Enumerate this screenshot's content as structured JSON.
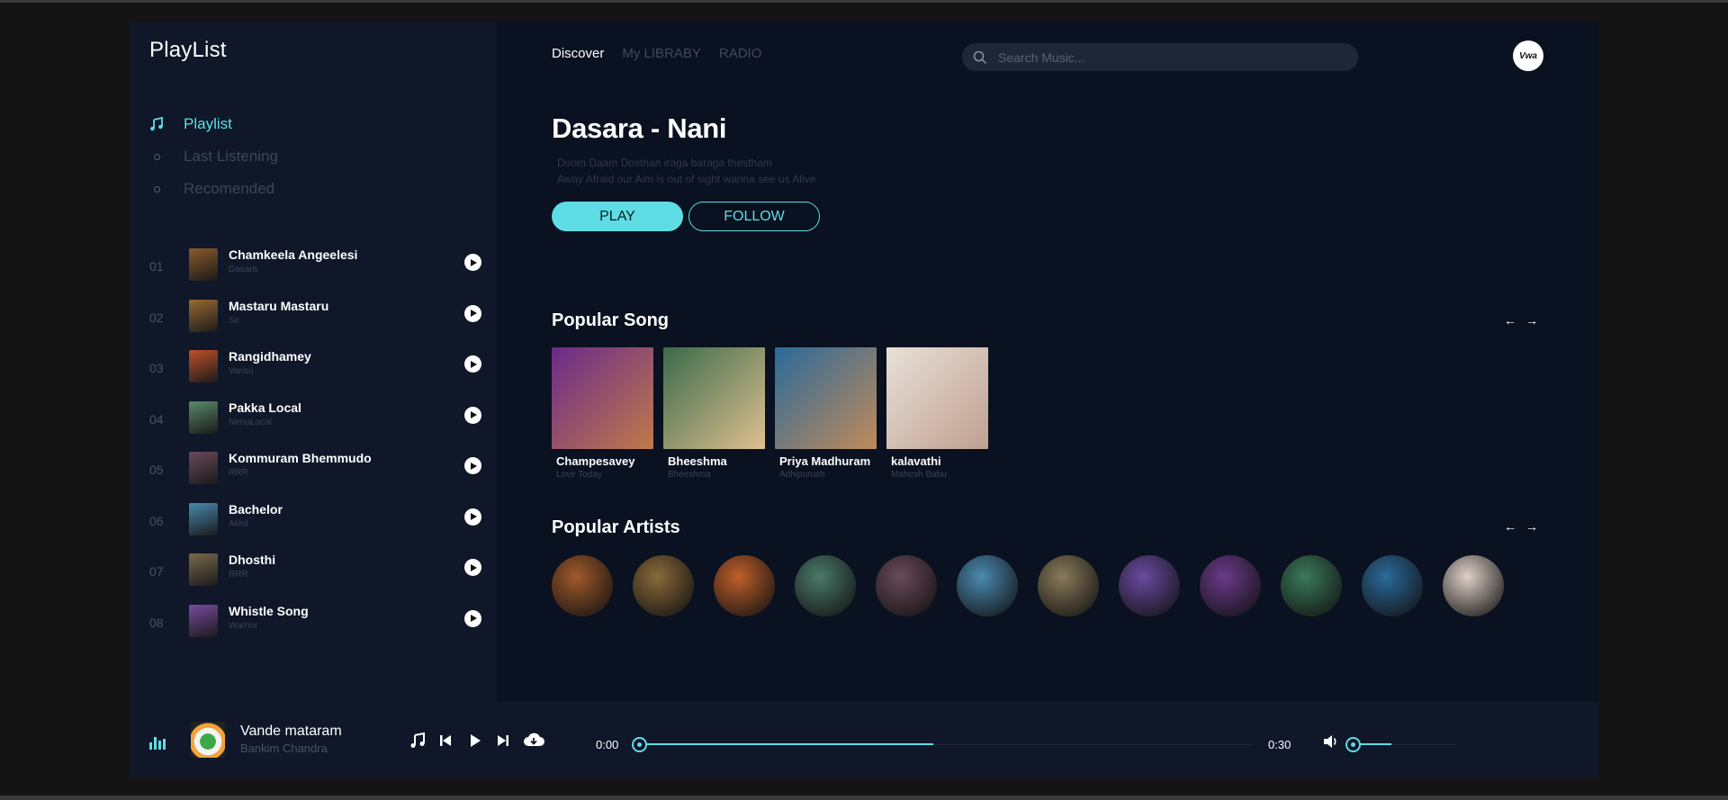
{
  "sidebar": {
    "brand": "PlayList",
    "nav": [
      {
        "label": "Playlist",
        "active": true,
        "icon": "music-note-icon"
      },
      {
        "label": "Last Listening",
        "active": false,
        "icon": "circle-icon"
      },
      {
        "label": "Recomended",
        "active": false,
        "icon": "circle-icon"
      }
    ],
    "tracks": [
      {
        "num": "01",
        "title": "Chamkeela Angeelesi",
        "artist": "Dasara",
        "color": "#8a5a2a"
      },
      {
        "num": "02",
        "title": "Mastaru Mastaru",
        "artist": "Sir",
        "color": "#9a6a30"
      },
      {
        "num": "03",
        "title": "Rangidhamey",
        "artist": "Varisu",
        "color": "#c0502a"
      },
      {
        "num": "04",
        "title": "Pakka Local",
        "artist": "NenuLocal",
        "color": "#5a8a6a"
      },
      {
        "num": "05",
        "title": "Kommuram Bhemmudo",
        "artist": "RRR",
        "color": "#6a4a5a"
      },
      {
        "num": "06",
        "title": "Bachelor",
        "artist": "Akhil",
        "color": "#4a8ab0"
      },
      {
        "num": "07",
        "title": "Dhosthi",
        "artist": "RRR",
        "color": "#7a6a4a"
      },
      {
        "num": "08",
        "title": "Whistle Song",
        "artist": "Warrior",
        "color": "#7a4aa0"
      }
    ]
  },
  "header": {
    "tabs": [
      "Discover",
      "My LIBRABY",
      "RADIO"
    ],
    "active_tab": 0,
    "search_placeholder": "Search Music...",
    "avatar_text": "Vwa"
  },
  "hero": {
    "title": "Dasara - Nani",
    "line1": "Doom Daam Dosthan iraga baraga thestham",
    "line2": "Away Afraid our Aim is out of sight wanna see us Alive",
    "play_label": "PLAY",
    "follow_label": "FOLLOW"
  },
  "popular_songs": {
    "title": "Popular Song",
    "items": [
      {
        "title": "Champesavey",
        "sub": "Love Today",
        "c1": "#6a2a8a",
        "c2": "#c07a4a"
      },
      {
        "title": "Bheeshma",
        "sub": "Bheeshma",
        "c1": "#3a6a4a",
        "c2": "#e0c090"
      },
      {
        "title": "Priya Madhuram",
        "sub": "Adhipurush",
        "c1": "#2a6a9a",
        "c2": "#c08a5a"
      },
      {
        "title": "kalavathi",
        "sub": "Mahesh Babu",
        "c1": "#e8e0d8",
        "c2": "#c0a090"
      }
    ]
  },
  "popular_artists": {
    "title": "Popular Artists",
    "colors": [
      "#a05a2a",
      "#8a6a3a",
      "#c0602a",
      "#4a7a6a",
      "#6a4a5a",
      "#4a8ab0",
      "#8a7a5a",
      "#6a4aa0",
      "#6a3a8a",
      "#3a7a5a",
      "#2a6a9a",
      "#e0d0c8"
    ]
  },
  "player": {
    "title": "Vande mataram",
    "artist": "Bankim Chandra",
    "time_current": "0:00",
    "time_total": "0:30",
    "progress": 0.48,
    "volume": 0.38
  }
}
